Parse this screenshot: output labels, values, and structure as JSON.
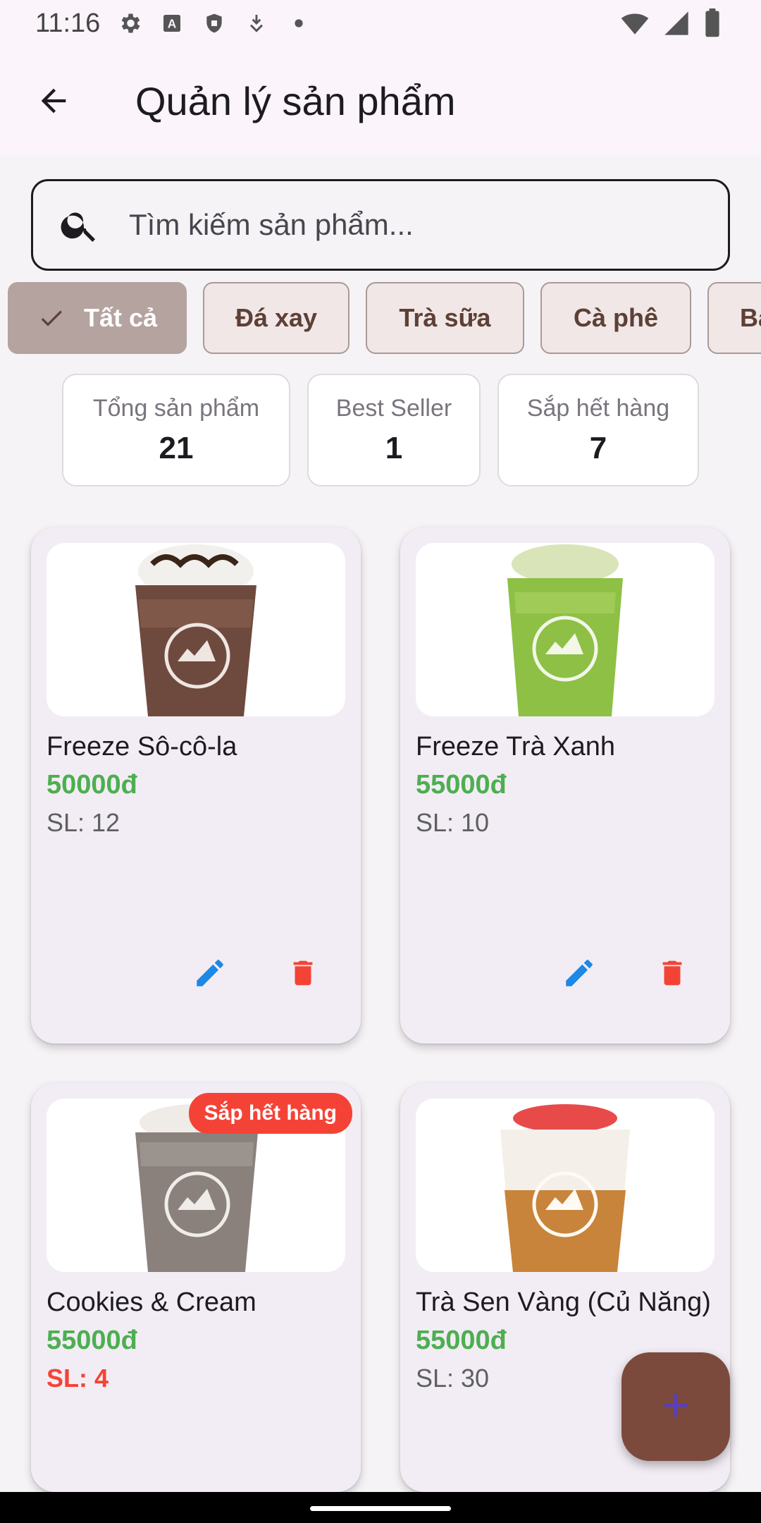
{
  "status_bar": {
    "time": "11:16",
    "icons": [
      "gear-icon",
      "a-box-icon",
      "shield-icon",
      "download-icon",
      "dot-icon",
      "wifi-icon",
      "signal-icon",
      "battery-icon"
    ]
  },
  "app_bar": {
    "title": "Quản lý sản phẩm",
    "back_icon": "arrow-back-icon"
  },
  "search": {
    "placeholder": "Tìm kiếm sản phẩm...",
    "value": ""
  },
  "filters": [
    {
      "label": "Tất cả",
      "selected": true
    },
    {
      "label": "Đá xay",
      "selected": false
    },
    {
      "label": "Trà sữa",
      "selected": false
    },
    {
      "label": "Cà phê",
      "selected": false
    },
    {
      "label": "Ba",
      "selected": false
    }
  ],
  "stats": [
    {
      "label": "Tổng sản phẩm",
      "value": "21"
    },
    {
      "label": "Best Seller",
      "value": "1"
    },
    {
      "label": "Sắp hết hàng",
      "value": "7"
    }
  ],
  "products": [
    {
      "name": "Freeze Sô-cô-la",
      "price": "50000đ",
      "qty": "SL: 12",
      "low_stock": false
    },
    {
      "name": "Freeze Trà Xanh",
      "price": "55000đ",
      "qty": "SL: 10",
      "low_stock": false
    },
    {
      "name": "Cookies & Cream",
      "price": "55000đ",
      "qty": "SL: 4",
      "low_stock": true,
      "badge": "Sắp hết hàng"
    },
    {
      "name": "Trà Sen Vàng (Củ Năng)",
      "price": "55000đ",
      "qty": "SL: 30",
      "low_stock": false
    }
  ],
  "colors": {
    "price_green": "#4caf50",
    "low_red": "#f44336",
    "edit_blue": "#1e88e5",
    "delete_red": "#f44336",
    "fab_brown": "#7b4a3c",
    "chip_selected": "#b5a39f",
    "chip_text": "#5d4037"
  },
  "fab": {
    "icon": "plus-icon"
  }
}
